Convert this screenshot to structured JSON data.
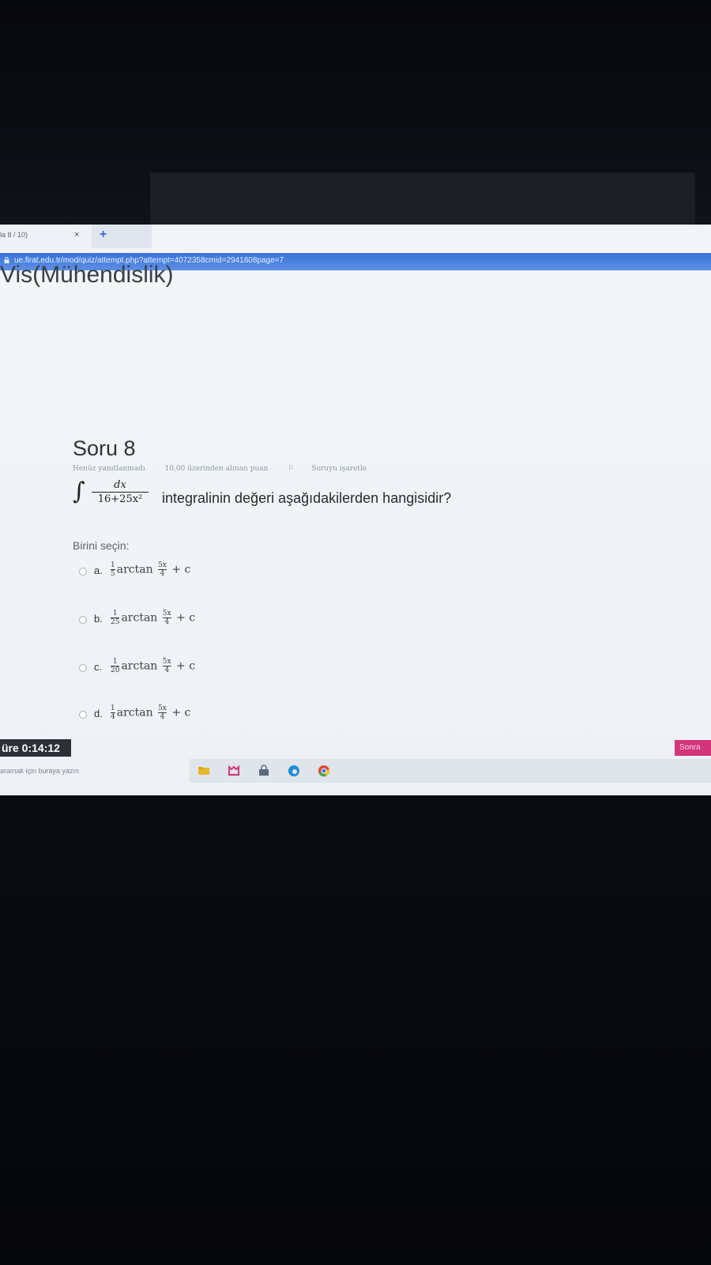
{
  "browser": {
    "tab_title": "la 8 / 10)",
    "tab_close": "×",
    "new_tab": "+",
    "url": "ue.firat.edu.tr/mod/quiz/attempt.php?attempt=4072358cmid=2941808page=7"
  },
  "page": {
    "course_title": "Vis(Mühendislik)"
  },
  "question": {
    "title": "Soru 8",
    "status": "Henüz yanıtlanmadı",
    "points": "10,00 üzerinden alınan puan",
    "flag_label": "Soruyu işaretle",
    "integral": {
      "sign": "∫",
      "numerator": "dx",
      "denominator": "16+25x²"
    },
    "text": "integralinin değeri aşağıdakilerden hangisidir?",
    "choose_label": "Birini seçin:",
    "answers": [
      {
        "letter": "a.",
        "coef_num": "1",
        "coef_den": "5",
        "fn": "arctan",
        "arg_num": "5x",
        "arg_den": "4",
        "tail": "+ c"
      },
      {
        "letter": "b.",
        "coef_num": "1",
        "coef_den": "25",
        "fn": "arctan",
        "arg_num": "5x",
        "arg_den": "4",
        "tail": "+ c"
      },
      {
        "letter": "c.",
        "coef_num": "1",
        "coef_den": "20",
        "fn": "arctan",
        "arg_num": "5x",
        "arg_den": "4",
        "tail": "+ c"
      },
      {
        "letter": "d.",
        "coef_num": "1",
        "coef_den": "4",
        "fn": "arctan",
        "arg_num": "5x",
        "arg_den": "4",
        "tail": "+ c"
      }
    ]
  },
  "footer": {
    "timer": "üre 0:14:12",
    "next_label": "Sonra"
  },
  "taskbar": {
    "search_placeholder": "aramak için buraya yazın",
    "icons": [
      "file-explorer-icon",
      "store-icon",
      "store-bag-icon",
      "edge-icon",
      "chrome-icon"
    ]
  },
  "colors": {
    "address_bar": "#3a73d8",
    "next_button": "#d4347a",
    "timer_bg": "#2b3036"
  }
}
